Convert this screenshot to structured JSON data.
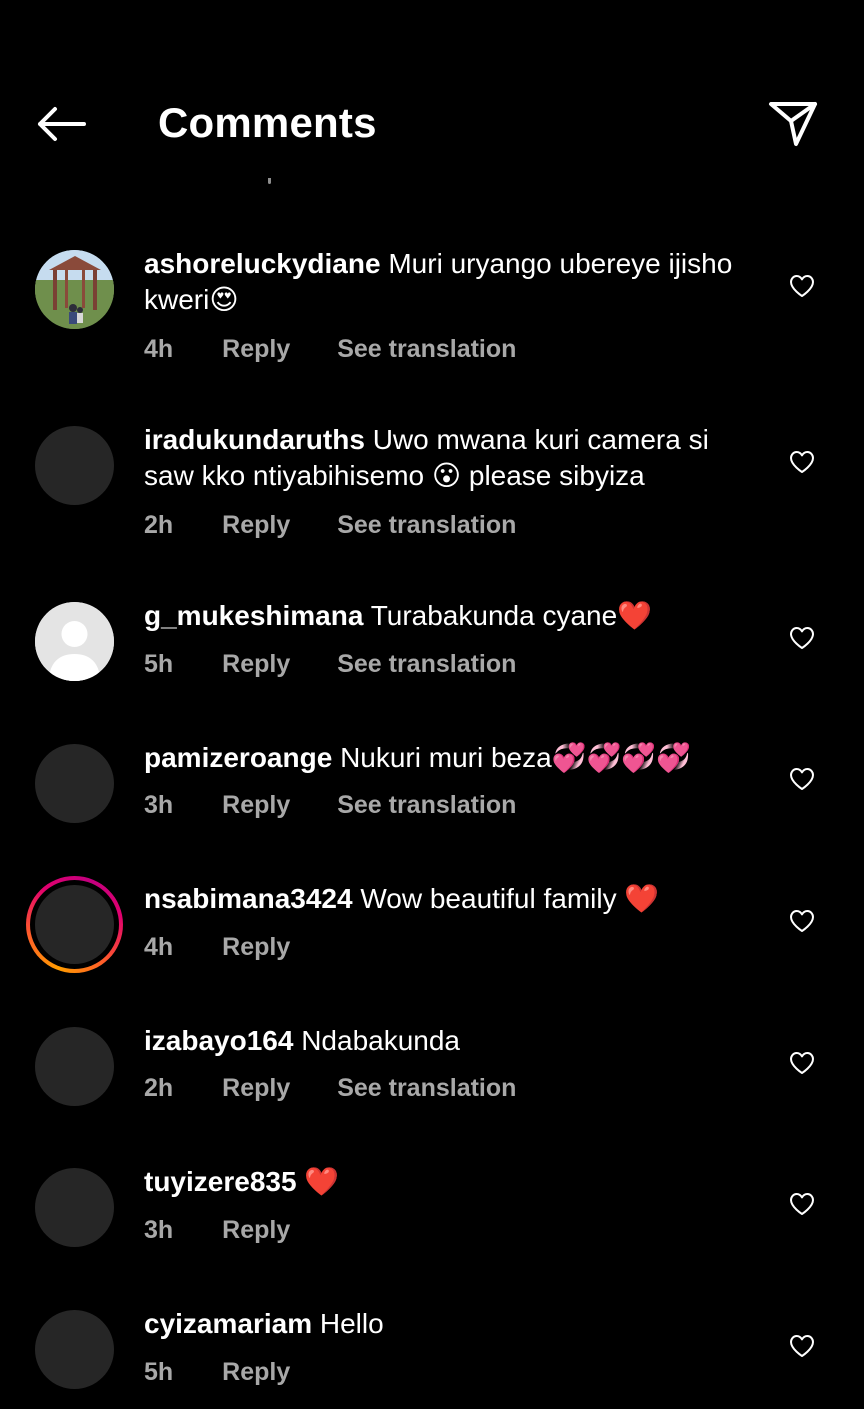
{
  "header": {
    "title": "Comments"
  },
  "comments": [
    {
      "username": "ashoreluckydiane",
      "text": "Muri uryango ubereye ijisho kweri😍",
      "time": "4h",
      "reply": "Reply",
      "translate": "See translation"
    },
    {
      "username": "iradukundaruths",
      "text": "Uwo mwana kuri camera si saw kko ntiyabihisemo 😮 please sibyiza",
      "time": "2h",
      "reply": "Reply",
      "translate": "See translation"
    },
    {
      "username": "g_mukeshimana",
      "text": "Turabakunda cyane❤️",
      "time": "5h",
      "reply": "Reply",
      "translate": "See translation"
    },
    {
      "username": "pamizeroange",
      "text": "Nukuri muri beza💞💞💞💞",
      "time": "3h",
      "reply": "Reply",
      "translate": "See translation"
    },
    {
      "username": "nsabimana3424",
      "text": "Wow beautiful family ❤️",
      "time": "4h",
      "reply": "Reply"
    },
    {
      "username": "izabayo164",
      "text": "Ndabakunda",
      "time": "2h",
      "reply": "Reply",
      "translate": "See translation"
    },
    {
      "username": "tuyizere835",
      "text": "❤️",
      "time": "3h",
      "reply": "Reply"
    },
    {
      "username": "cyizamariam",
      "text": "Hello",
      "time": "5h",
      "reply": "Reply"
    }
  ],
  "colors": {
    "background": "#000000",
    "text": "#ffffff",
    "secondary_text": "#a8a8a8",
    "avatar_placeholder": "#262626",
    "story_ring": "#e1006e"
  },
  "icons": {
    "back": "arrow-left-icon",
    "share": "paper-plane-icon",
    "like": "heart-outline-icon"
  }
}
